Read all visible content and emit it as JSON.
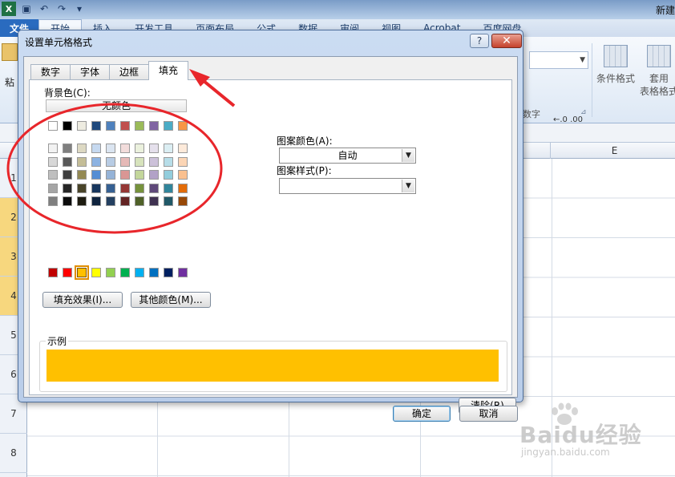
{
  "excel": {
    "title_right": "新建",
    "ribbon_tabs": [
      "文件",
      "开始",
      "插入",
      "开发工具",
      "页面布局",
      "公式",
      "数据",
      "审阅",
      "视图",
      "Acrobat",
      "百度网盘"
    ],
    "paste_label": "粘",
    "number_group_label": "数字",
    "decimal_buttons": "←.0  .00",
    "cond_format_label": "条件格式",
    "table_format_label": "套用\n表格格式",
    "column_E": "E",
    "row_numbers": [
      "1",
      "2",
      "3",
      "4",
      "5",
      "6",
      "7",
      "8"
    ],
    "selected_rows": [
      1,
      2,
      3
    ]
  },
  "dialog": {
    "title": "设置单元格格式",
    "help": "?",
    "close": "✕",
    "tabs": [
      "数字",
      "字体",
      "边框",
      "填充"
    ],
    "active_tab": "填充",
    "background_color_label": "背景色(C):",
    "no_color_button": "无颜色",
    "theme_colors_top": [
      "#ffffff",
      "#000000",
      "#eeece1",
      "#1f497d",
      "#4f81bd",
      "#c0504d",
      "#9bbb59",
      "#8064a2",
      "#4bacc6",
      "#f79646"
    ],
    "theme_tints": [
      [
        "#f2f2f2",
        "#7f7f7f",
        "#ddd9c3",
        "#c6d9f0",
        "#dbe5f1",
        "#f2dcdb",
        "#ebf1dd",
        "#e5e0ec",
        "#dbeef3",
        "#fdeada"
      ],
      [
        "#d8d8d8",
        "#595959",
        "#c4bd97",
        "#8db3e2",
        "#b8cce4",
        "#e5b9b7",
        "#d7e3bc",
        "#ccc1d9",
        "#b7dde8",
        "#fbd5b5"
      ],
      [
        "#bfbfbf",
        "#3f3f3f",
        "#938953",
        "#548dd4",
        "#95b3d7",
        "#d99694",
        "#c3d69b",
        "#b2a2c7",
        "#92cddc",
        "#fac08f"
      ],
      [
        "#a5a5a5",
        "#262626",
        "#494429",
        "#17365d",
        "#366092",
        "#953734",
        "#76923c",
        "#5f497a",
        "#31859b",
        "#e36c09"
      ],
      [
        "#7f7f7f",
        "#0c0c0c",
        "#1d1b10",
        "#0f243e",
        "#244061",
        "#632423",
        "#4f6128",
        "#3f3151",
        "#205867",
        "#974806"
      ]
    ],
    "standard_colors": [
      "#c00000",
      "#ff0000",
      "#ffc000",
      "#ffff00",
      "#92d050",
      "#00b050",
      "#00b0f0",
      "#0070c0",
      "#002060",
      "#7030a0"
    ],
    "selected_standard_index": 2,
    "fill_effects_button": "填充效果(I)...",
    "more_colors_button": "其他颜色(M)...",
    "pattern_color_label": "图案颜色(A):",
    "pattern_color_value": "自动",
    "pattern_style_label": "图案样式(P):",
    "pattern_style_value": "",
    "sample_label": "示例",
    "sample_color": "#ffc000",
    "clear_button": "清除(R)",
    "ok_button": "确定",
    "cancel_button": "取消"
  },
  "watermark": {
    "brand": "Baidu经验",
    "url": "jingyan.baidu.com"
  },
  "annotation_color": "#e8262b"
}
